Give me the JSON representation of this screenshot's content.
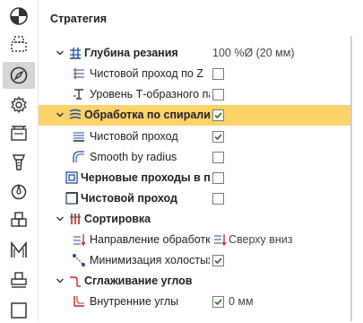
{
  "toolbar": {
    "items": [
      {
        "name": "pie-chart-icon"
      },
      {
        "name": "selection-box-icon"
      },
      {
        "name": "compass-icon",
        "active": true
      },
      {
        "name": "gear-icon"
      },
      {
        "name": "machine-table-icon"
      },
      {
        "name": "tool-holder-icon"
      },
      {
        "name": "tool-drop-icon"
      },
      {
        "name": "blocks-icon"
      },
      {
        "name": "m-letter-icon"
      },
      {
        "name": "stamp-icon"
      },
      {
        "name": "square-icon"
      }
    ]
  },
  "panel": {
    "title": "Стратегия",
    "rows": {
      "depth_label": "Глубина резания",
      "depth_value": "100 %Ø (20 мм)",
      "finish_z_label": "Чистовой проход по Z",
      "tslot_label": "Уровень Т-образного паза",
      "spiral_label": "Обработка по спирали",
      "spiral_finish_label": "Чистовой проход",
      "smooth_radius_label": "Smooth by radius",
      "rough_passes_label": "Черновые проходы в плоскости",
      "finish_pass_label": "Чистовой проход",
      "sorting_label": "Сортировка",
      "direction_label": "Направление обработки",
      "direction_value": "Сверху вниз",
      "minimize_label": "Минимизация холостых ходов",
      "corner_smooth_label": "Сглаживание углов",
      "inner_corners_label": "Внутренние углы",
      "inner_corners_value": "0 мм"
    },
    "checks": {
      "finish_z": false,
      "tslot": false,
      "spiral": true,
      "spiral_finish": true,
      "smooth_radius": false,
      "rough_passes": false,
      "finish_pass": false,
      "minimize": true,
      "inner_corners": true
    }
  },
  "colors": {
    "highlight": "#ffd36c",
    "check": "#2e7d32",
    "accent_red": "#cc2222",
    "accent_blue": "#1a4fa0"
  }
}
